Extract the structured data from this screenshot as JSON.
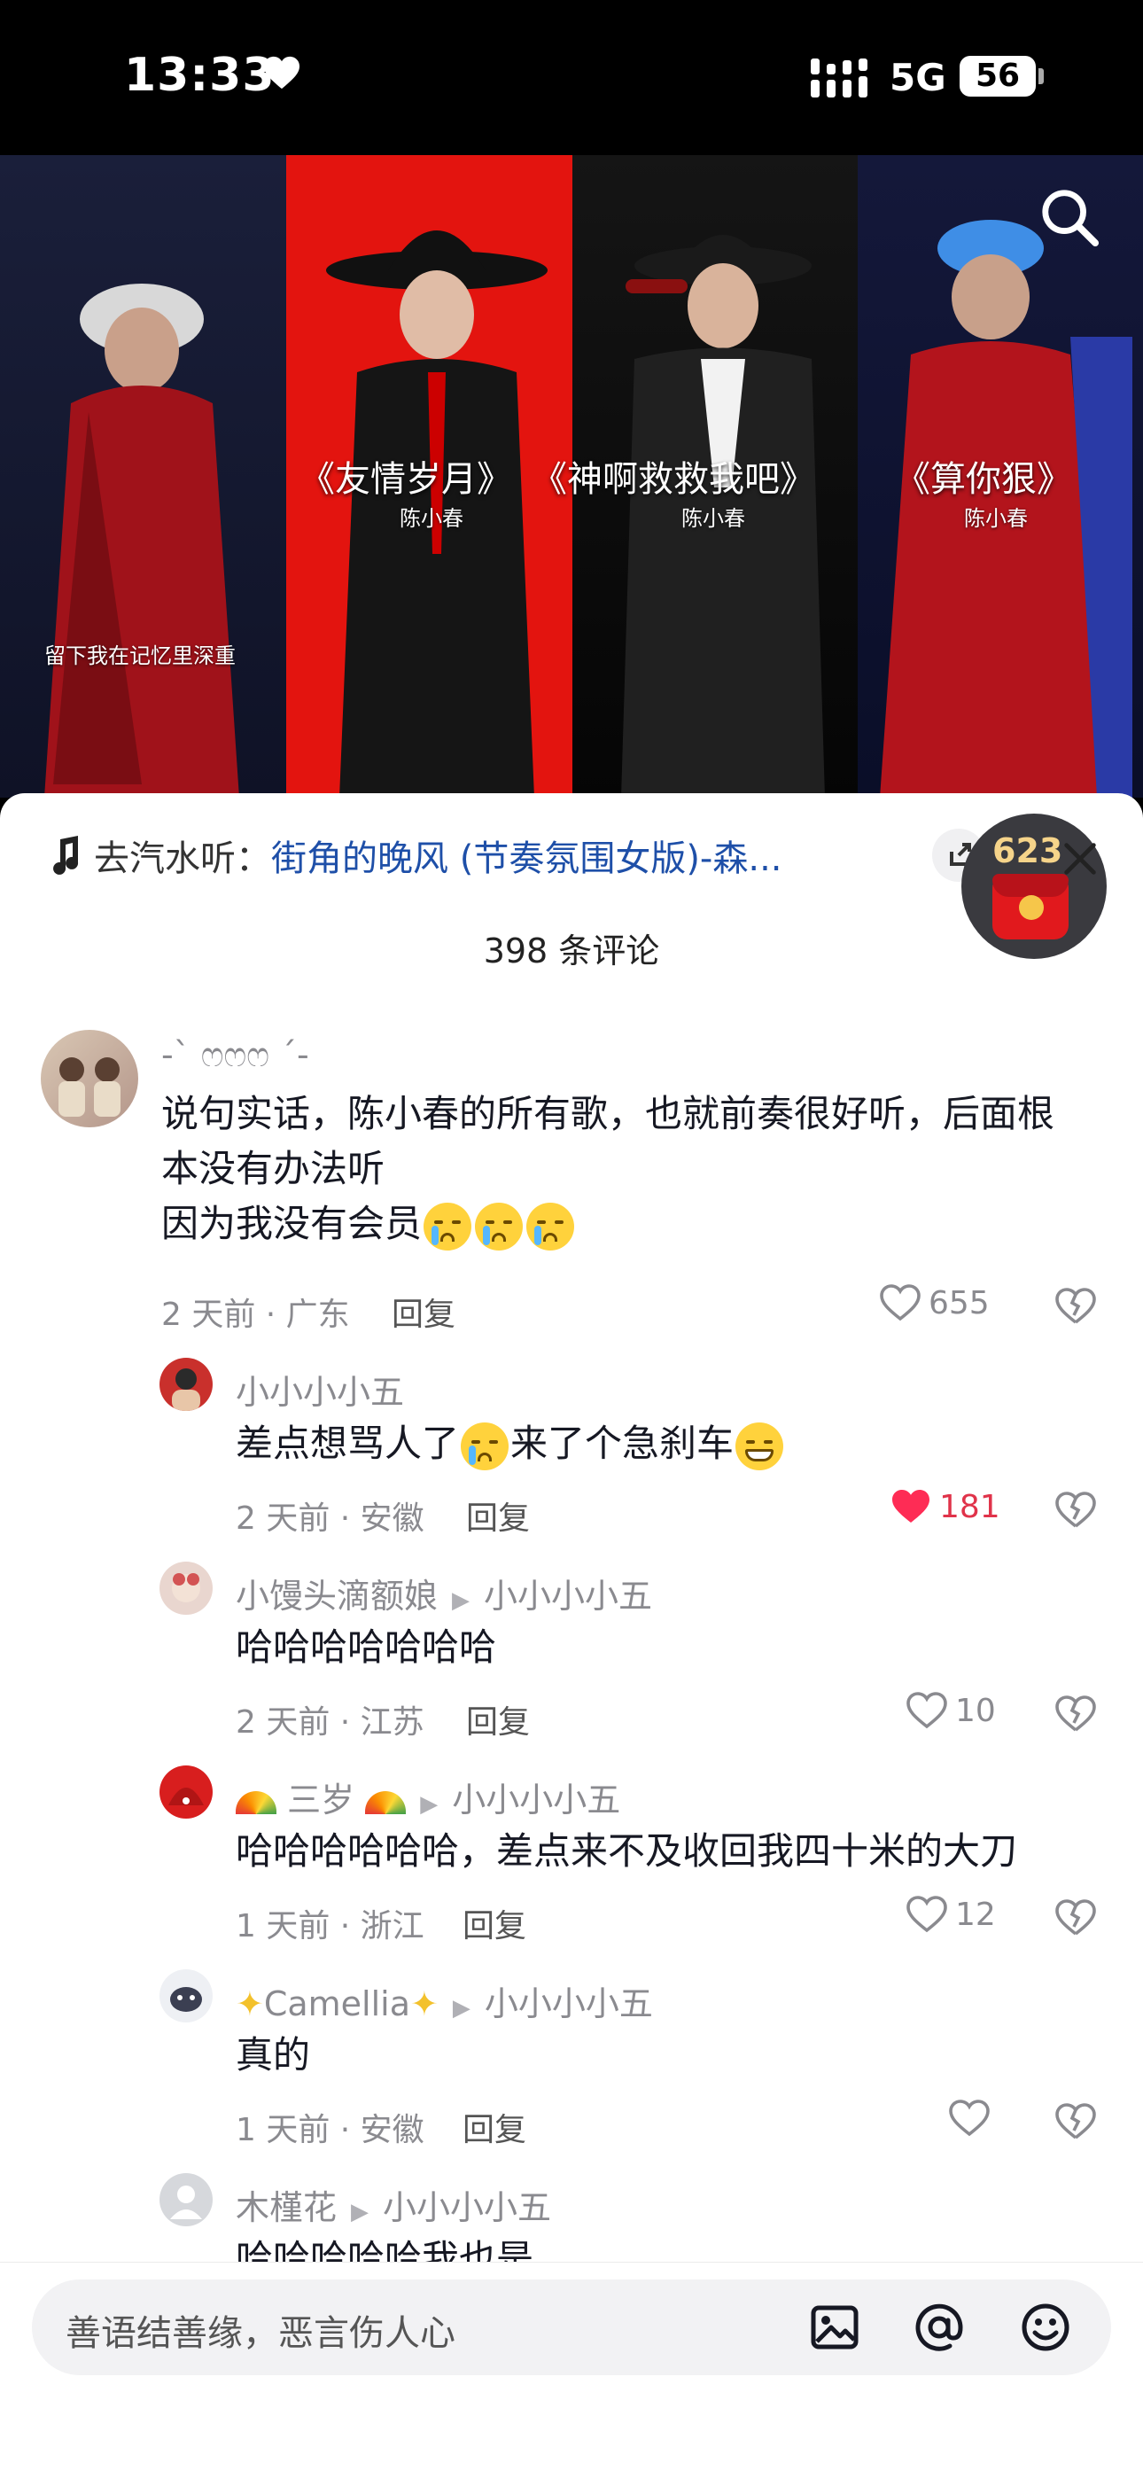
{
  "status_bar": {
    "time": "13:33",
    "network": "5G",
    "battery": "56"
  },
  "video": {
    "songs": [
      {
        "title": "《友情岁月》",
        "artist": "陈小春"
      },
      {
        "title": "《神啊救救我吧》",
        "artist": "陈小春"
      },
      {
        "title": "《算你狠》",
        "artist": "陈小春"
      }
    ],
    "lyric": "留下我在记忆里深重"
  },
  "music": {
    "prefix": "去汽水听：",
    "title": "街角的晚风 (节奏氛围女版)-森..."
  },
  "red_packet": {
    "count": "623"
  },
  "comment_count": "398 条评论",
  "comments": [
    {
      "user": "-ˋ ෆෆෆ ˊ-",
      "text_line1": "说句实话，陈小春的所有歌，也就前奏很好听，后面根",
      "text_line2": "本没有办法听",
      "text_line3": "因为我没有会员",
      "meta": "2 天前 · 广东",
      "reply": "回复",
      "likes": "655"
    },
    {
      "user": "小小小小五",
      "text_a": "差点想骂人了",
      "text_b": "来了个急刹车",
      "meta": "2 天前 · 安徽",
      "reply": "回复",
      "likes": "181"
    },
    {
      "user": "小馒头滴额娘",
      "reply_to": "小小小小五",
      "text": "哈哈哈哈哈哈哈",
      "meta": "2 天前 · 江苏",
      "reply": "回复",
      "likes": "10"
    },
    {
      "user": "三岁",
      "reply_to": "小小小小五",
      "text": "哈哈哈哈哈哈，差点来不及收回我四十米的大刀",
      "meta": "1 天前 · 浙江",
      "reply": "回复",
      "likes": "12"
    },
    {
      "user": "Camellia",
      "reply_to": "小小小小五",
      "text": "真的",
      "meta": "1 天前 · 安徽",
      "reply": "回复",
      "likes": ""
    },
    {
      "user": "木槿花",
      "reply_to": "小小小小五",
      "text": "哈哈哈哈哈我也是"
    }
  ],
  "input": {
    "placeholder": "善语结善缘，恶言伤人心"
  },
  "icons": {
    "heart": "heart-icon",
    "search": "search-icon",
    "music": "music-note-icon",
    "share": "share-icon",
    "close": "close-icon",
    "like": "like-heart-icon",
    "dislike": "dislike-broken-heart-icon",
    "image": "image-icon",
    "mention": "at-mention-icon",
    "emoji": "emoji-icon"
  },
  "colors": {
    "accent_link": "#1e4fa8",
    "like_active": "#fe2c55",
    "video_red": "#e3140f"
  }
}
